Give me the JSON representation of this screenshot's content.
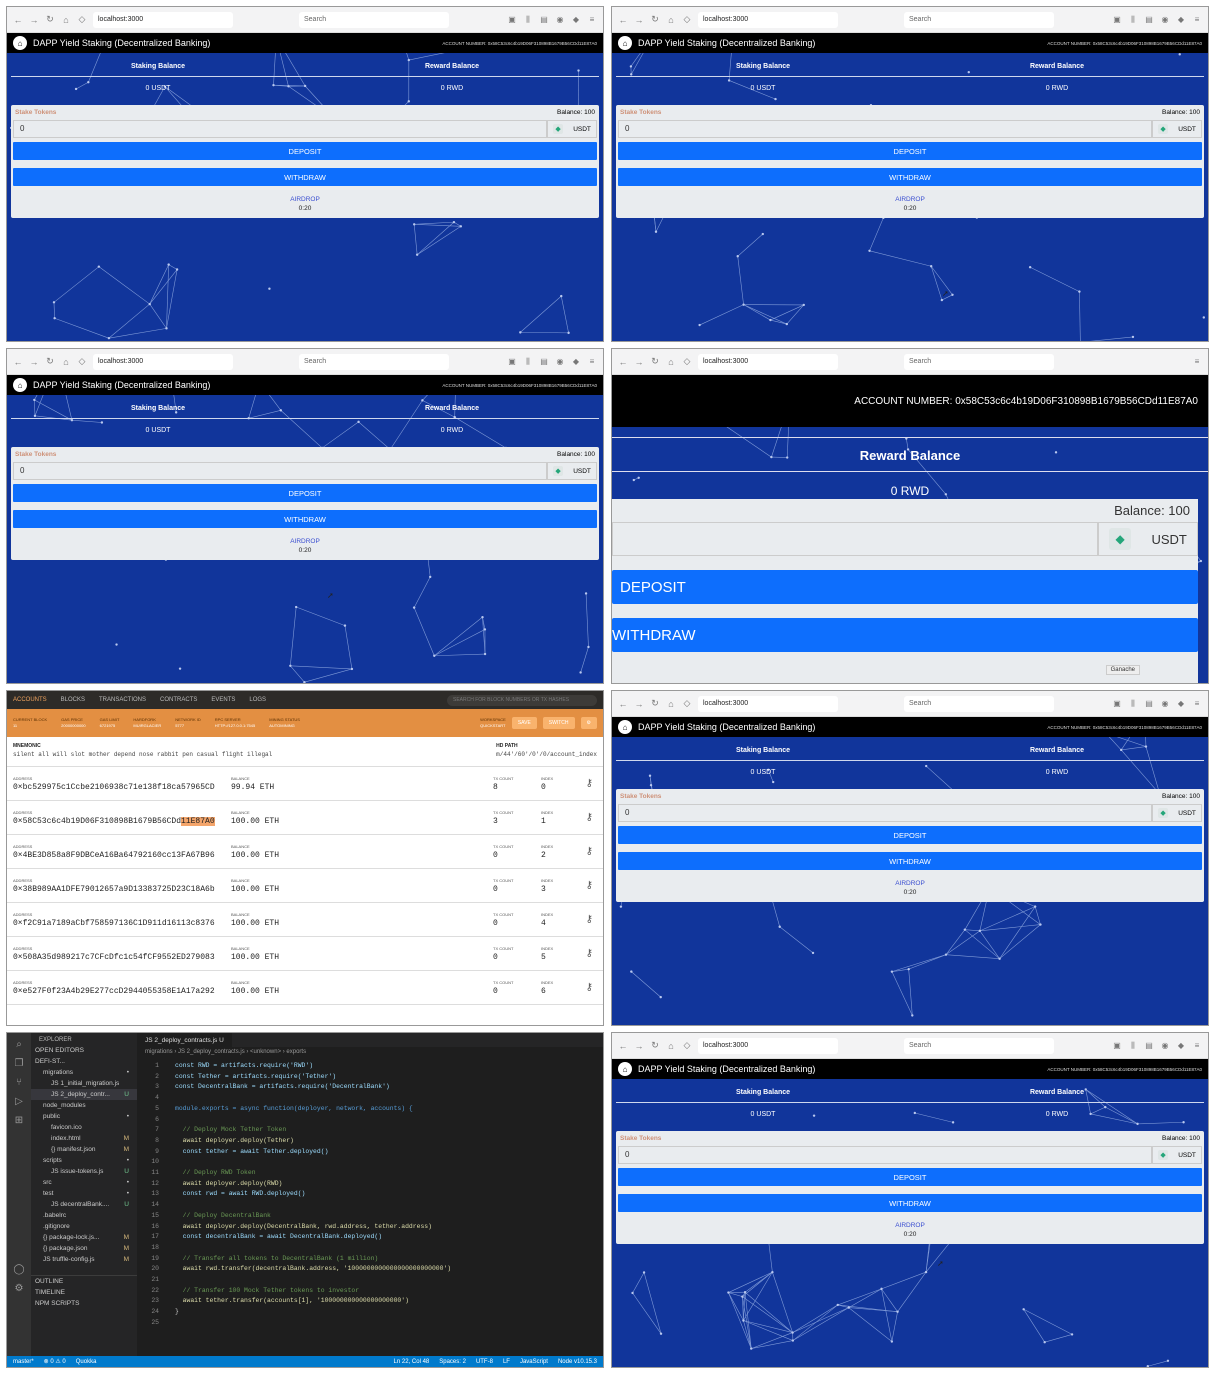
{
  "browser": {
    "url": "localhost:3000",
    "search_placeholder": "Search"
  },
  "dapp": {
    "title": "DAPP Yield Staking (Decentralized Banking)",
    "account": "ACCOUNT NUMBER: 0x58C53c6c4b19D06F310898B1679B56CDd11E87A0",
    "staking_label": "Staking Balance",
    "staking_value": "0 USDT",
    "reward_label": "Reward Balance",
    "reward_value": "0 RWD",
    "stake_tokens": "Stake Tokens",
    "balance": "Balance: 100",
    "input_value": "0",
    "token": "USDT",
    "deposit": "DEPOSIT",
    "withdraw": "WITHDRAW",
    "airdrop": "AIRDROP",
    "timer": "0:20",
    "ganache_tip": "Ganache"
  },
  "ganache": {
    "tabs": [
      "ACCOUNTS",
      "BLOCKS",
      "TRANSACTIONS",
      "CONTRACTS",
      "EVENTS",
      "LOGS"
    ],
    "search_placeholder": "SEARCH FOR BLOCK NUMBERS OR TX HASHES",
    "stats": [
      {
        "k": "CURRENT BLOCK",
        "v": "11"
      },
      {
        "k": "GAS PRICE",
        "v": "20000000000"
      },
      {
        "k": "GAS LIMIT",
        "v": "6721975"
      },
      {
        "k": "HARDFORK",
        "v": "MUIRGLACIER"
      },
      {
        "k": "NETWORK ID",
        "v": "5777"
      },
      {
        "k": "RPC SERVER",
        "v": "HTTP://127.0.0.1:7545"
      },
      {
        "k": "MINING STATUS",
        "v": "AUTOMINING"
      }
    ],
    "workspace_k": "WORKSPACE",
    "workspace_v": "QUICKSTART",
    "save": "SAVE",
    "switch": "SWITCH",
    "mnemonic_label": "MNEMONIC",
    "mnemonic": "silent all will slot mother depend nose rabbit pen casual flight illegal",
    "hdpath_label": "HD PATH",
    "hdpath": "m/44'/60'/0'/0/account_index",
    "labels": {
      "address": "ADDRESS",
      "balance": "BALANCE",
      "tx": "TX COUNT",
      "index": "INDEX"
    },
    "accounts": [
      {
        "address": "0×bc529975c1Ccbe2106938c71e138f18ca57965CD",
        "balance": "99.94 ETH",
        "tx": "8",
        "index": "0"
      },
      {
        "address_a": "0×58C53c6c4b19D06F310898B1679B56CDd",
        "address_b": "11E87A0",
        "balance": "100.00 ETH",
        "tx": "3",
        "index": "1"
      },
      {
        "address": "0×4BE3D858a8F9DBCeA16Ba64792160cc13FA67B96",
        "balance": "100.00 ETH",
        "tx": "0",
        "index": "2"
      },
      {
        "address": "0×38B989AA1DFE79012657a9D13383725D23C18A6b",
        "balance": "100.00 ETH",
        "tx": "0",
        "index": "3"
      },
      {
        "address": "0×f2C91a7189aCbf758597136C1D911d16113c8376",
        "balance": "100.00 ETH",
        "tx": "0",
        "index": "4"
      },
      {
        "address": "0×508A35d989217c7CFcDfc1c54fCF9552ED279083",
        "balance": "100.00 ETH",
        "tx": "0",
        "index": "5"
      },
      {
        "address": "0×e527F0f23A4b29E277ccD2944055358E1A17a292",
        "balance": "100.00 ETH",
        "tx": "0",
        "index": "6"
      }
    ]
  },
  "vscode": {
    "explorer": "EXPLORER",
    "open_editors": "OPEN EDITORS",
    "tab": "JS 2_deploy_contracts.js U",
    "breadcrumb": "migrations › JS 2_deploy_contracts.js › <unknown> › exports",
    "tree": [
      {
        "n": "DEFI-ST...",
        "s": "",
        "i": 0
      },
      {
        "n": "migrations",
        "s": "•",
        "i": 1
      },
      {
        "n": "JS 1_initial_migration.js",
        "s": "",
        "i": 2
      },
      {
        "n": "JS 2_deploy_contr...",
        "s": "U",
        "i": 2,
        "sel": true
      },
      {
        "n": "node_modules",
        "s": "",
        "i": 1
      },
      {
        "n": "public",
        "s": "•",
        "i": 1
      },
      {
        "n": "favicon.ico",
        "s": "",
        "i": 2
      },
      {
        "n": "index.html",
        "s": "M",
        "i": 2
      },
      {
        "n": "{} manifest.json",
        "s": "M",
        "i": 2
      },
      {
        "n": "scripts",
        "s": "•",
        "i": 1
      },
      {
        "n": "JS issue-tokens.js",
        "s": "U",
        "i": 2
      },
      {
        "n": "src",
        "s": "•",
        "i": 1
      },
      {
        "n": "test",
        "s": "•",
        "i": 1
      },
      {
        "n": "JS decentralBank....",
        "s": "U",
        "i": 2
      },
      {
        "n": ".babelrc",
        "s": "",
        "i": 1
      },
      {
        "n": ".gitignore",
        "s": "",
        "i": 1
      },
      {
        "n": "{} package-lock.js...",
        "s": "M",
        "i": 1
      },
      {
        "n": "{} package.json",
        "s": "M",
        "i": 1
      },
      {
        "n": "JS truffle-config.js",
        "s": "M",
        "i": 1
      }
    ],
    "outline": "OUTLINE",
    "timeline": "TIMELINE",
    "npm": "NPM SCRIPTS",
    "status_left": [
      "master*",
      "⊗ 0 ⚠ 0",
      "Quokka"
    ],
    "status_right": [
      "Ln 22, Col 48",
      "Spaces: 2",
      "UTF-8",
      "LF",
      "JavaScript",
      "Node v10.15.3"
    ]
  },
  "code_lines": [
    "const RWD = artifacts.require('RWD')",
    "const Tether = artifacts.require('Tether')",
    "const DecentralBank = artifacts.require('DecentralBank')",
    "",
    "module.exports = async function(deployer, network, accounts) {",
    "",
    "  // Deploy Mock Tether Token",
    "  await deployer.deploy(Tether)",
    "  const tether = await Tether.deployed()",
    "",
    "  // Deploy RWD Token",
    "  await deployer.deploy(RWD)",
    "  const rwd = await RWD.deployed()",
    "",
    "  // Deploy DecentralBank",
    "  await deployer.deploy(DecentralBank, rwd.address, tether.address)",
    "  const decentralBank = await DecentralBank.deployed()",
    "",
    "  // Transfer all tokens to DecentralBank (1 million)",
    "  await rwd.transfer(decentralBank.address, '1000000000000000000000000')",
    "",
    "  // Transfer 100 Mock Tether tokens to investor",
    "  await tether.transfer(accounts[1], '100000000000000000000')",
    "}",
    ""
  ]
}
